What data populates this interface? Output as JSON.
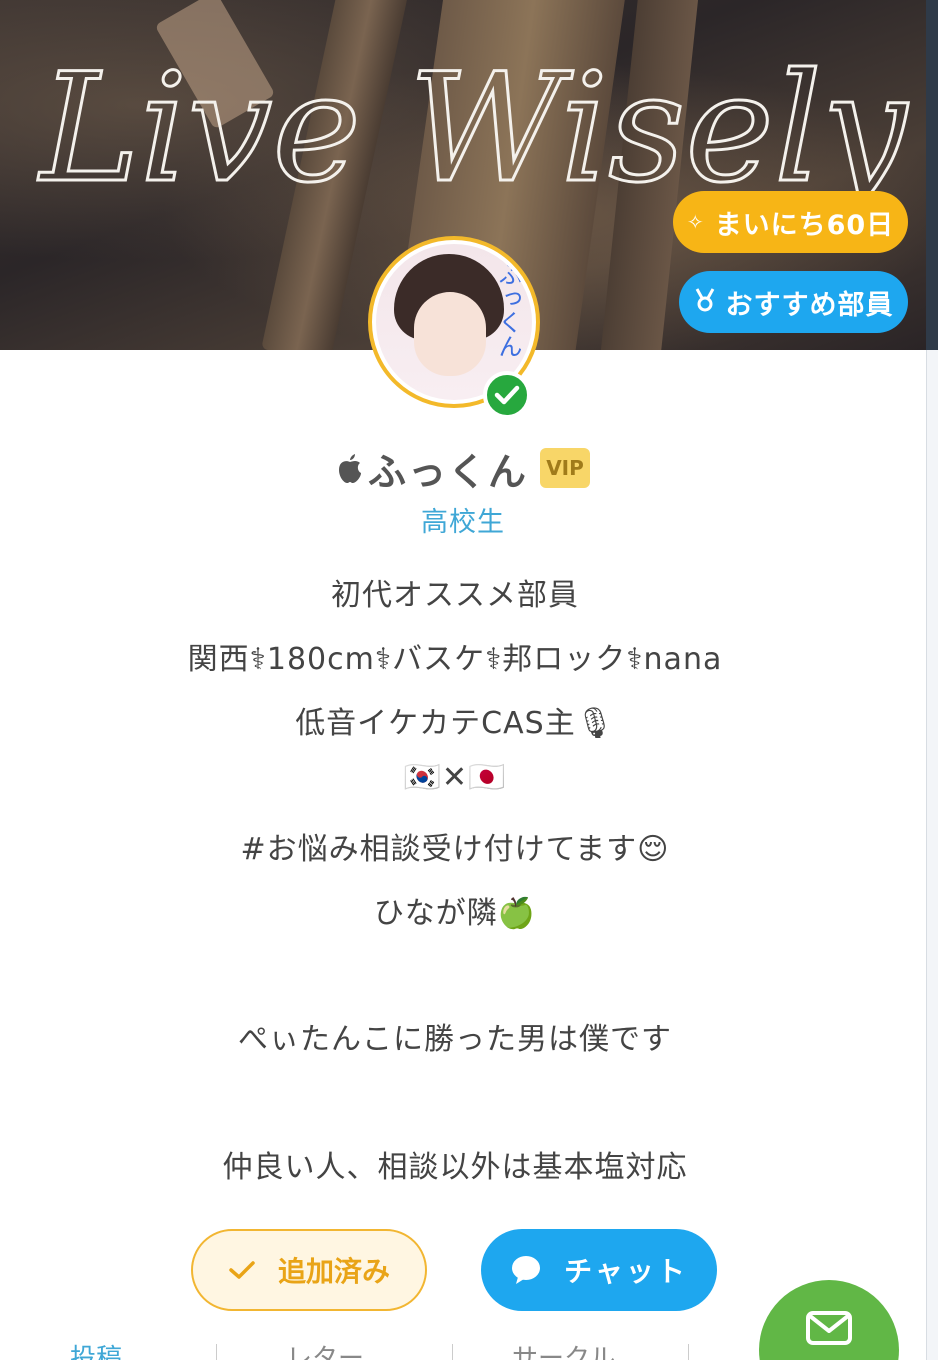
{
  "banner": {
    "script_text": "Live Wisely",
    "streak_badge": "まいにち60日",
    "recommend_badge": "おすすめ部員"
  },
  "profile": {
    "avatar_overlay_text": "ふっくん",
    "name": "ふっくん",
    "vip_label": "VIP",
    "grade": "高校生",
    "bio": [
      "初代オススメ部員",
      "関西⚕180cm⚕バスケ⚕邦ロック⚕nana",
      "低音イケカテCAS主🎙",
      "🇰🇷✕🇯🇵",
      "#お悩み相談受け付けてます😌",
      "ひなが隣🍏",
      "ぺぃたんこに勝った男は僕です",
      "仲良い人、相談以外は基本塩対応"
    ]
  },
  "actions": {
    "added_label": "追加済み",
    "chat_label": "チャット"
  },
  "tabs": {
    "posts": "投稿",
    "letter": "レター",
    "circle": "サークル"
  },
  "colors": {
    "accent_blue": "#1ea7ef",
    "accent_yellow": "#f7b516",
    "verified_green": "#27a83e",
    "mail_green": "#61b746"
  },
  "icons": {
    "streak": "sparkle-icon",
    "recommend": "medal-icon",
    "verified": "check-icon",
    "added": "check-icon",
    "chat": "chat-bubble-icon",
    "mail": "envelope-icon",
    "apple": "apple-icon"
  }
}
